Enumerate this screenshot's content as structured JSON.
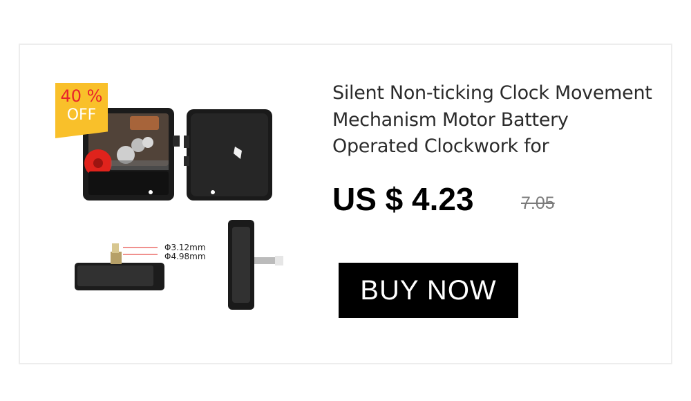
{
  "badge": {
    "percent": "40 %",
    "off": "OFF"
  },
  "product": {
    "title": "Silent Non-ticking Clock Movement Mechanism Motor Battery Operated Clockwork for",
    "price": "US $ 4.23",
    "old_price": "7.05",
    "buy_label": "BUY NOW",
    "dimensions": {
      "shaft_1": "Φ3.12mm",
      "shaft_2": "Φ4.98mm"
    }
  },
  "colors": {
    "badge_bg": "#f9c02a",
    "badge_percent": "#e8232b",
    "button_bg": "#000000"
  }
}
